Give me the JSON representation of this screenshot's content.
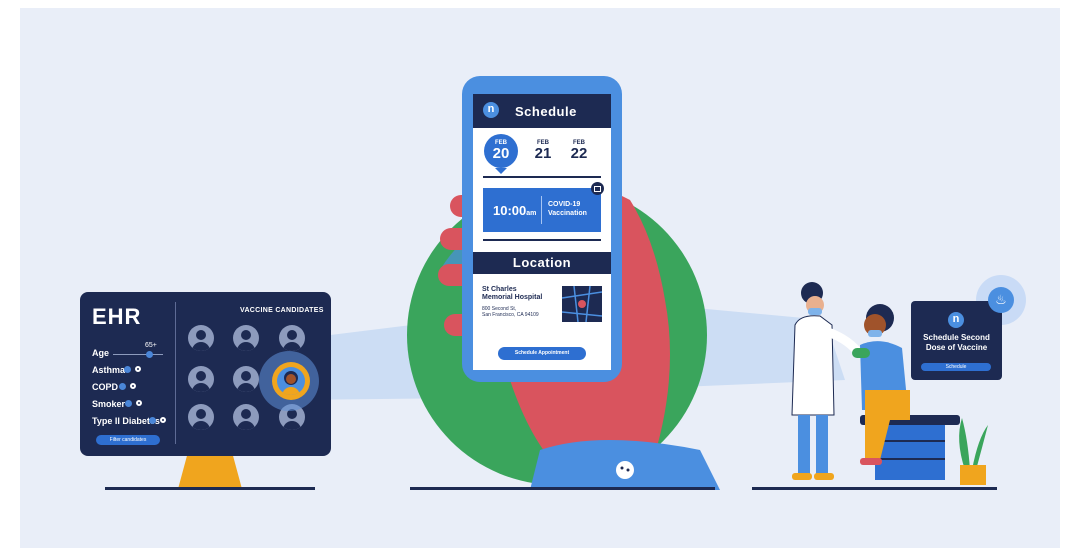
{
  "ehr": {
    "title": "EHR",
    "candidates_title": "VACCINE CANDIDATES",
    "age_label": "Age",
    "age_value": "65+",
    "conditions": [
      "Asthma",
      "COPD",
      "Smoker",
      "Type II Diabetes"
    ],
    "filter_button": "Filter candidates"
  },
  "phone": {
    "logo": "n",
    "schedule_title": "Schedule",
    "dates": [
      {
        "month": "FEB",
        "day": "20"
      },
      {
        "month": "FEB",
        "day": "21"
      },
      {
        "month": "FEB",
        "day": "22"
      }
    ],
    "appointment_time": "10:00",
    "appointment_ampm": "am",
    "appointment_line1": "COVID-19",
    "appointment_line2": "Vaccination",
    "location_title": "Location",
    "hospital_line1": "St Charles",
    "hospital_line2": "Memorial Hospital",
    "address_line1": "800 Second St,",
    "address_line2": "San Francisco, CA 94109",
    "schedule_button": "Schedule Appointment"
  },
  "notification": {
    "logo": "n",
    "line1": "Schedule Second",
    "line2": "Dose of Vaccine",
    "button": "Schedule"
  },
  "colors": {
    "navy": "#1d2a52",
    "blue": "#2e6fd1",
    "light_blue": "#4b8fe0",
    "green": "#3aa55c",
    "hand": "#d9545e",
    "background": "#e9eef8"
  }
}
